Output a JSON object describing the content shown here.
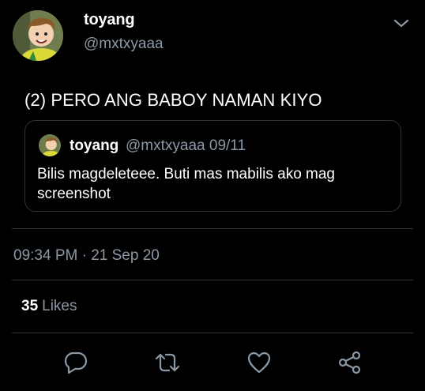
{
  "header": {
    "display_name": "toyang",
    "handle": "@mxtxyaaa"
  },
  "tweet": {
    "text": "(2) PERO ANG BABOY NAMAN KIYO"
  },
  "quoted_tweet": {
    "display_name": "toyang",
    "meta": "@mxtxyaaa 09/11",
    "text": "Bilis magdeleteee. Buti mas mabilis ako mag screenshot"
  },
  "timestamp": "09:34 PM · 21 Sep 20",
  "stats": {
    "likes_count": "35",
    "likes_label": "Likes"
  },
  "actions": [
    "reply-icon",
    "retweet-icon",
    "like-icon",
    "share-icon"
  ],
  "colors": {
    "background": "#000000",
    "text_primary": "#ffffff",
    "text_secondary": "#8b98a5",
    "border": "#2f3336"
  }
}
